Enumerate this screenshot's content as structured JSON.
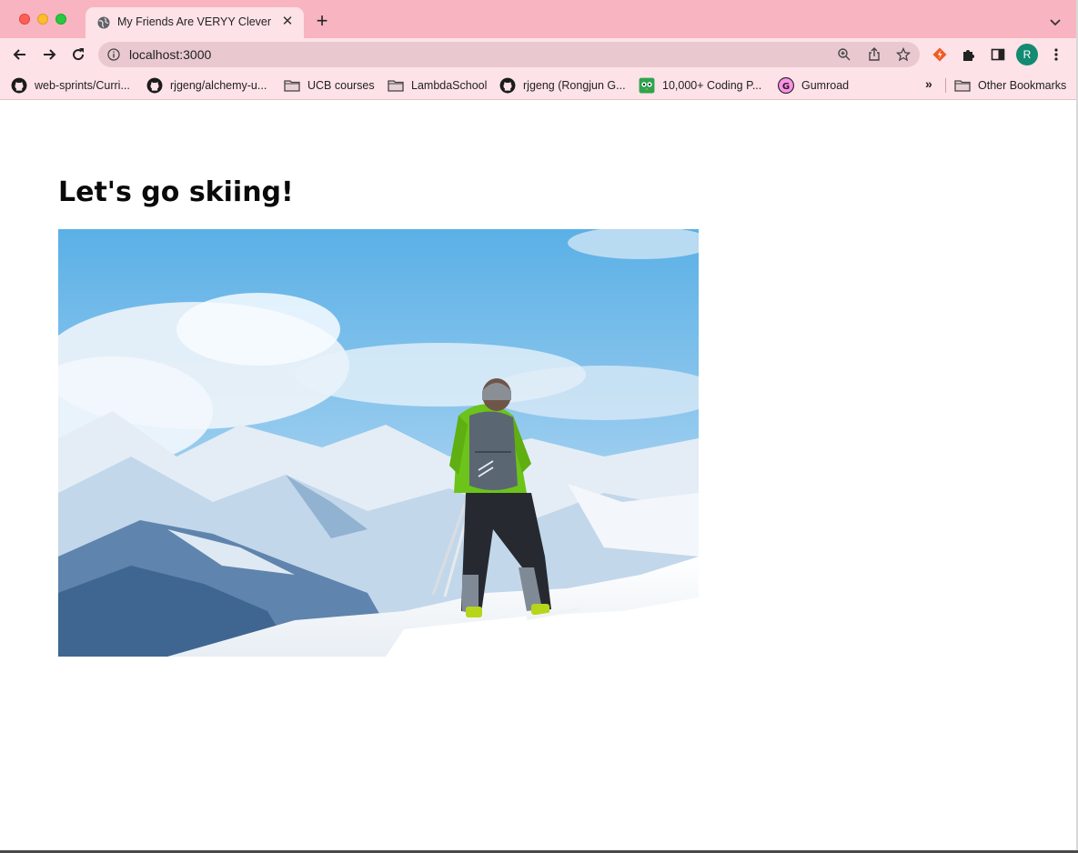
{
  "browser": {
    "tab": {
      "title": "My Friends Are VERYY Clever",
      "close_glyph": "✕"
    },
    "new_tab_glyph": "+",
    "address_bar": {
      "url": "localhost:3000"
    },
    "profile_initial": "R",
    "bookmarks": [
      {
        "label": "web-sprints/Curri...",
        "icon": "github-icon"
      },
      {
        "label": "rjgeng/alchemy-u...",
        "icon": "github-icon"
      },
      {
        "label": "UCB courses",
        "icon": "folder-icon"
      },
      {
        "label": "LambdaSchool",
        "icon": "folder-icon"
      },
      {
        "label": "rjgeng (Rongjun G...",
        "icon": "github-icon"
      },
      {
        "label": "10,000+ Coding P...",
        "icon": "owl-icon"
      },
      {
        "label": "Gumroad",
        "icon": "gumroad-icon"
      }
    ],
    "more_bookmarks_glyph": "»",
    "other_bookmarks": "Other Bookmarks"
  },
  "page": {
    "heading": "Let's go skiing!",
    "image": {
      "subject": "skier-on-mountain-photo"
    }
  },
  "colors": {
    "tab_strip": "#f8b4c0",
    "toolbar": "#fde2e7",
    "avatar": "#138a72"
  }
}
